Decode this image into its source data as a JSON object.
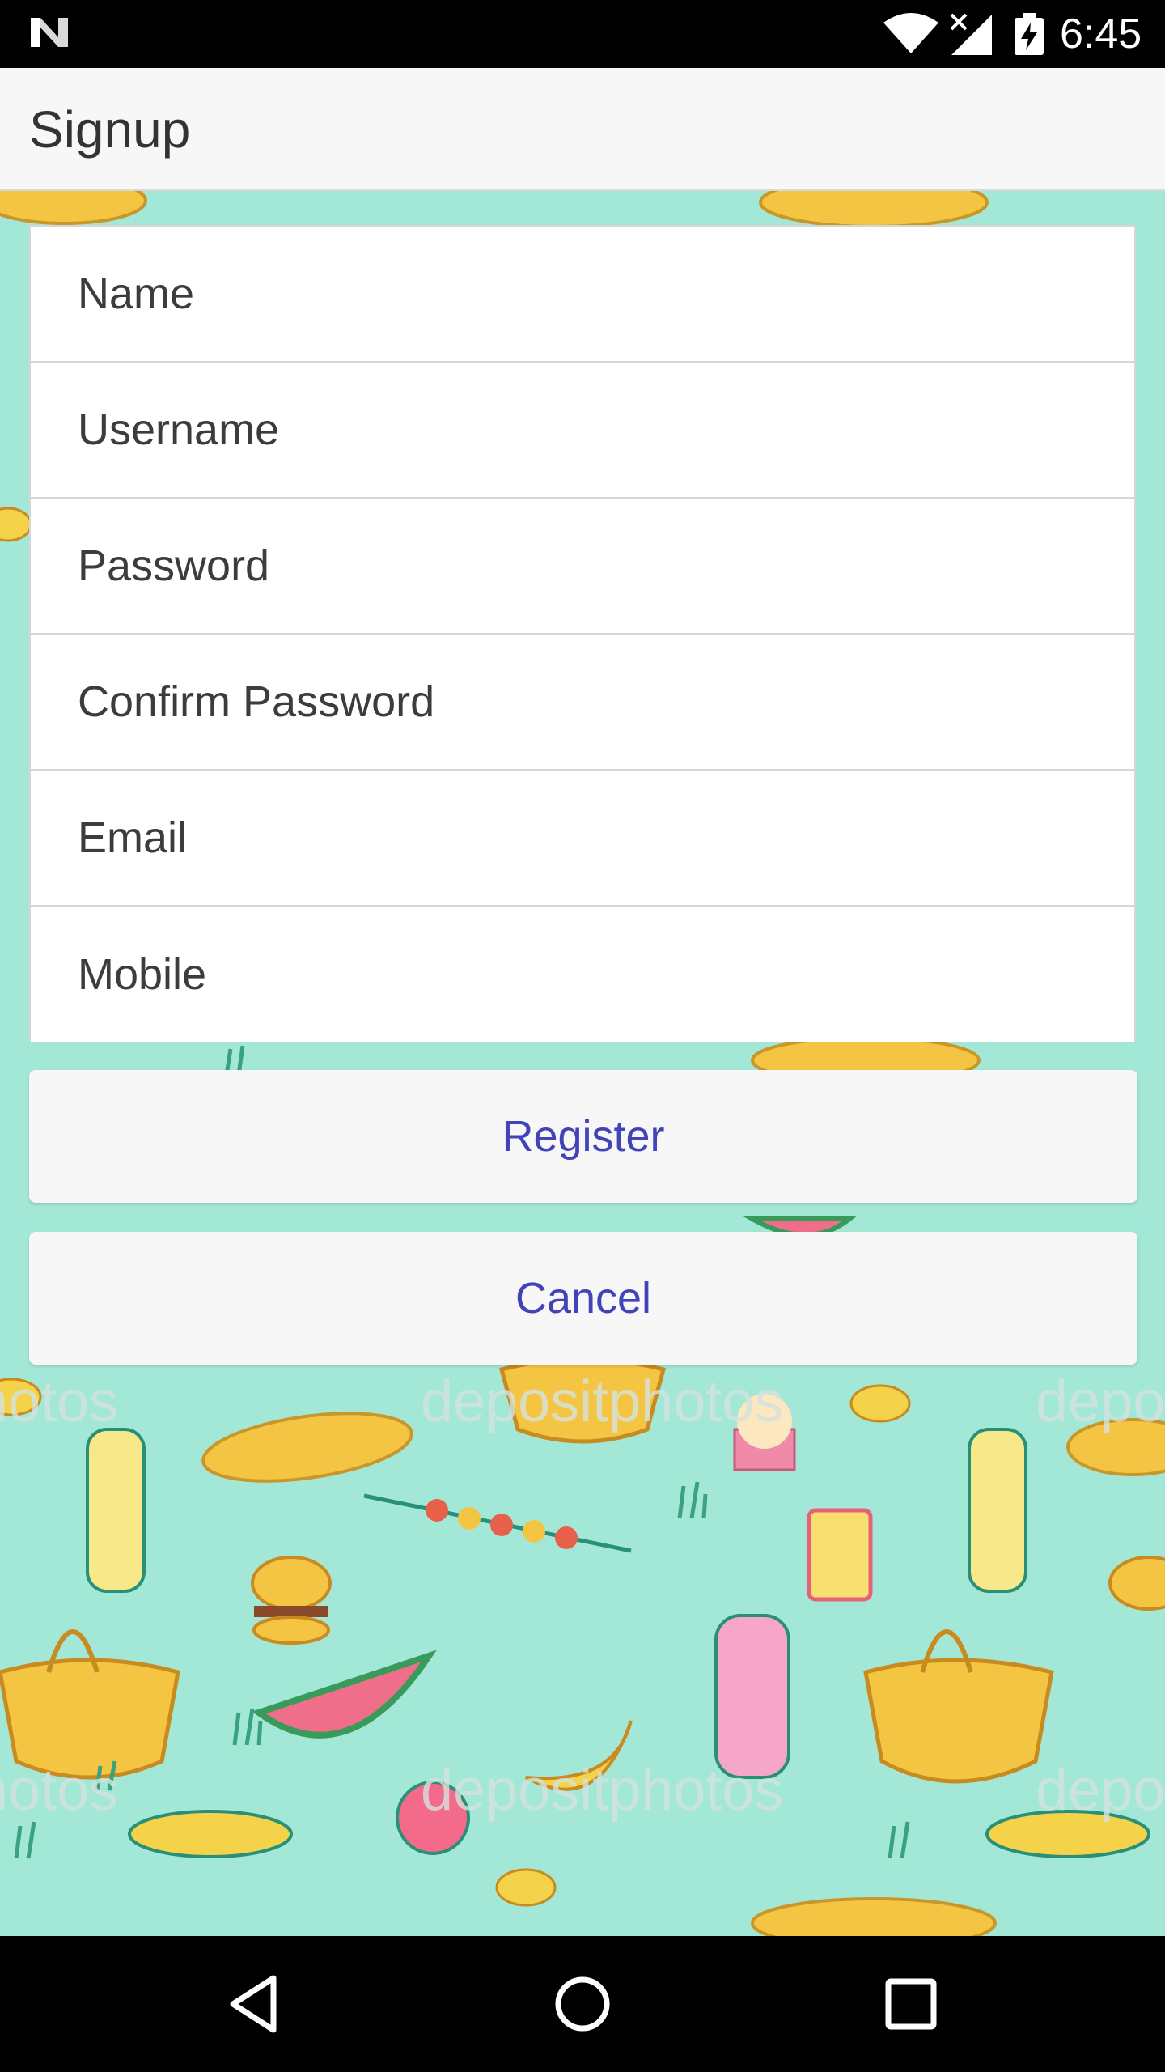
{
  "status_bar": {
    "time": "6:45",
    "icons": [
      "n-logo-icon",
      "wifi-icon",
      "cell-signal-icon",
      "battery-charging-icon"
    ]
  },
  "app_bar": {
    "title": "Signup"
  },
  "form": {
    "fields": [
      {
        "placeholder": "Name",
        "value": ""
      },
      {
        "placeholder": "Username",
        "value": ""
      },
      {
        "placeholder": "Password",
        "value": ""
      },
      {
        "placeholder": "Confirm Password",
        "value": ""
      },
      {
        "placeholder": "Email",
        "value": ""
      },
      {
        "placeholder": "Mobile",
        "value": ""
      }
    ]
  },
  "actions": {
    "register_label": "Register",
    "cancel_label": "Cancel"
  },
  "nav_bar": {
    "icons": [
      "back-icon",
      "home-icon",
      "recents-icon"
    ]
  },
  "colors": {
    "background": "#a3e8d6",
    "button_text": "#4343b8",
    "app_bar": "#f7f7f7"
  },
  "background_watermark": "depositphotos"
}
